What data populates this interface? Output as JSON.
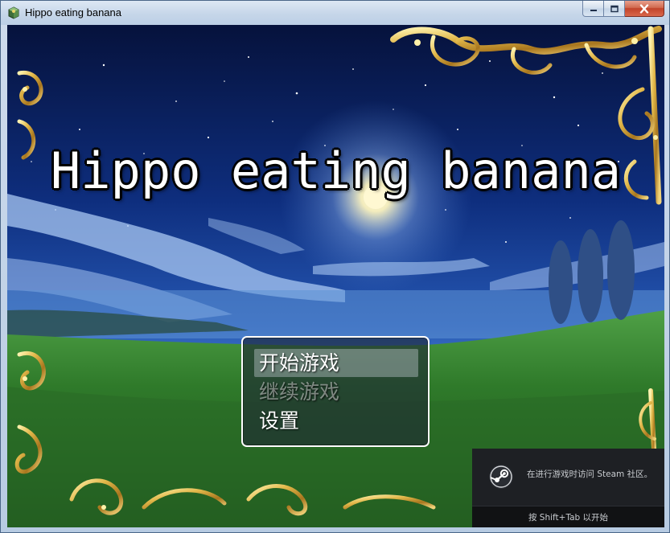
{
  "window": {
    "title": "Hippo eating banana"
  },
  "game": {
    "title": "Hippo eating banana"
  },
  "menu": {
    "items": [
      {
        "label": "开始游戏",
        "state": "selected"
      },
      {
        "label": "继续游戏",
        "state": "disabled"
      },
      {
        "label": "设置",
        "state": "normal"
      }
    ]
  },
  "steam_overlay": {
    "message": "在进行游戏时访问 Steam 社区。",
    "hint": "按 Shift+Tab 以开始"
  },
  "colors": {
    "frame_gold": "#e2b84a",
    "sky_top": "#06123c",
    "grass": "#2f7a2a"
  }
}
